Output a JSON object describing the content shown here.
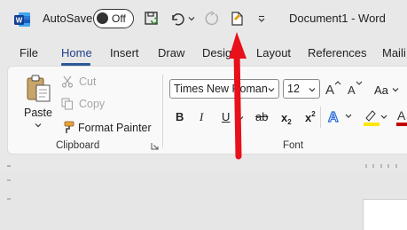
{
  "titlebar": {
    "autosave_label": "AutoSave",
    "autosave_state": "Off",
    "document_title": "Document1  -  Word"
  },
  "tabs": [
    {
      "label": "File"
    },
    {
      "label": "Home"
    },
    {
      "label": "Insert"
    },
    {
      "label": "Draw"
    },
    {
      "label": "Design"
    },
    {
      "label": "Layout"
    },
    {
      "label": "References"
    },
    {
      "label": "Maili"
    }
  ],
  "clipboard": {
    "paste_label": "Paste",
    "cut_label": "Cut",
    "copy_label": "Copy",
    "format_painter_label": "Format Painter",
    "group_label": "Clipboard"
  },
  "font": {
    "font_name": "Times New Roman",
    "font_size": "12",
    "change_case_label": "Aa",
    "bold_label": "B",
    "italic_label": "I",
    "underline_label": "U",
    "strikethrough_label": "ab",
    "subscript_label": "x",
    "superscript_label": "x",
    "subscript_mark": "2",
    "superscript_mark": "2",
    "group_label": "Font"
  },
  "colors": {
    "accent": "#2b5797",
    "arrow": "#e8101a",
    "highlight": "#ffe600",
    "font_color": "#c00000"
  },
  "icons": [
    "word-logo-icon",
    "save-sync-icon",
    "undo-icon",
    "redo-icon",
    "new-doc-icon",
    "customize-qat-icon",
    "paste-icon",
    "cut-icon",
    "copy-icon",
    "format-painter-icon",
    "dialog-launcher-icon",
    "text-effects-icon",
    "highlight-icon",
    "font-color-icon",
    "grow-font-icon",
    "shrink-font-icon"
  ]
}
